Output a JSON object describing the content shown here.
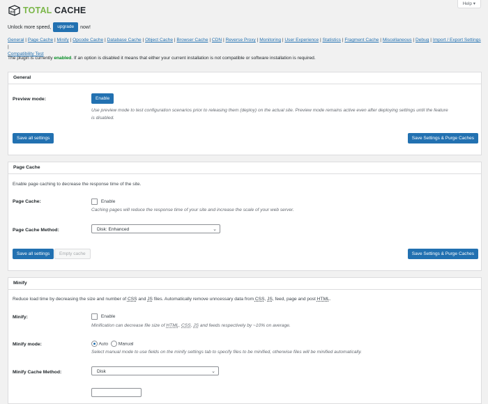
{
  "header": {
    "logo_badge": "W3",
    "logo_word1": "TOTAL",
    "logo_word2": "CACHE",
    "help_label": "Help ▾"
  },
  "promo": {
    "text_before": "Unlock more speed,",
    "button": "upgrade",
    "text_after": "now!"
  },
  "nav_links": [
    "General",
    "Page Cache",
    "Minify",
    "Opcode Cache",
    "Database Cache",
    "Object Cache",
    "Browser Cache",
    "CDN",
    "Reverse Proxy",
    "Monitoring",
    "User Experience",
    "Statistics",
    "Fragment Cache",
    "Miscellaneous",
    "Debug",
    "Import / Export Settings",
    "Compatibility Test"
  ],
  "status": {
    "before": "The plugin is currently",
    "state": "enabled",
    "after": ". If an option is disabled it means that either your current installation is not compatible or software installation is required."
  },
  "general": {
    "title": "General",
    "preview_label": "Preview mode:",
    "enable_button": "Enable",
    "preview_desc_1": "Use preview mode to test configuration scenarios prior to releasing them (deploy) on the actual site. Preview mode remains active even after deploying settings until the feature",
    "preview_desc_2": "is disabled.",
    "save_all": "Save all settings",
    "save_purge": "Save Settings & Purge Caches"
  },
  "page_cache": {
    "title": "Page Cache",
    "intro": "Enable page caching to decrease the response time of the site.",
    "label": "Page Cache:",
    "enable_label": "Enable",
    "desc": "Caching pages will reduce the response time of your site and increase the scale of your web server.",
    "method_label": "Page Cache Method:",
    "method_value": "Disk: Enhanced",
    "save_all": "Save all settings",
    "empty_cache": "Empty cache",
    "save_purge": "Save Settings & Purge Caches"
  },
  "minify": {
    "title": "Minify",
    "intro_1": "Reduce load time by decreasing the size and number of",
    "css": "CSS",
    "and": "and",
    "js": "JS",
    "intro_2": "files. Automatically remove unncessary data from",
    "intro_3": ", feed, page and post",
    "html": "HTML",
    "label": "Minify:",
    "enable_label": "Enable",
    "desc_1": "Minification can decrease file size of",
    "desc_2": "and feeds respectively by ~10% on average.",
    "mode_label": "Minify mode:",
    "mode_auto": "Auto",
    "mode_manual": "Manual",
    "mode_desc": "Select manual mode to use fields on the minify settings tab to specify files to be minified, otherwise files will be minified automatically.",
    "cache_method_label": "Minify Cache Method:",
    "cache_method_value": "Disk"
  }
}
